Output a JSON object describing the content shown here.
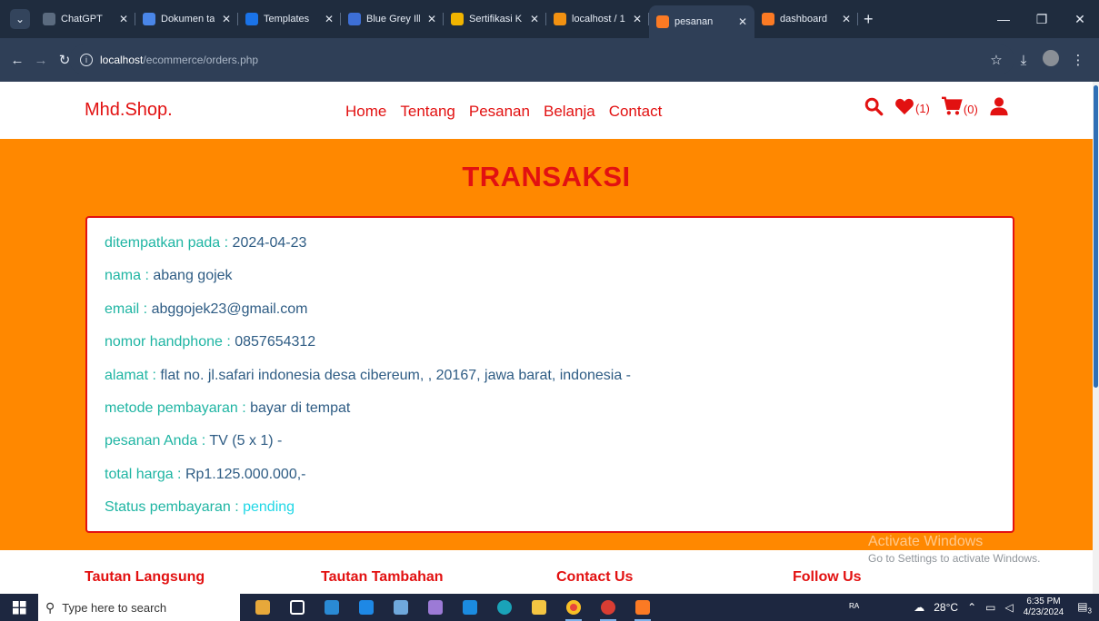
{
  "browser": {
    "tabs": [
      {
        "title": "ChatGPT",
        "icon": "chatgpt-icon",
        "color": "#5b6b7f",
        "active": false
      },
      {
        "title": "Dokumen ta",
        "icon": "docs-icon",
        "color": "#4a86e8",
        "active": false
      },
      {
        "title": "Templates",
        "icon": "templates-icon",
        "color": "#1a73e8",
        "active": false
      },
      {
        "title": "Blue Grey Ill",
        "icon": "youtube-icon",
        "color": "#3d6fd6",
        "active": false
      },
      {
        "title": "Sertifikasi K",
        "icon": "sertifikasi-icon",
        "color": "#f0b400",
        "active": false
      },
      {
        "title": "localhost / 1",
        "icon": "phpmyadmin-icon",
        "color": "#f29111",
        "active": false
      },
      {
        "title": "pesanan",
        "icon": "xampp-icon",
        "color": "#fb7a24",
        "active": true
      },
      {
        "title": "dashboard",
        "icon": "xampp-icon",
        "color": "#fb7a24",
        "active": false
      }
    ],
    "url_host": "localhost",
    "url_path": "/ecommerce/orders.php"
  },
  "site": {
    "logo": "Mhd.Shop.",
    "nav": [
      "Home",
      "Tentang",
      "Pesanan",
      "Belanja",
      "Contact"
    ],
    "wishlist_count": "(1)",
    "cart_count": "(0)",
    "brand_color": "#e21111",
    "section_bg": "#ff8800"
  },
  "orders": {
    "title": "TRANSAKSI",
    "order": [
      {
        "label": "ditempatkan pada : ",
        "value": "2024-04-23"
      },
      {
        "label": "nama : ",
        "value": "abang gojek"
      },
      {
        "label": "email : ",
        "value": "abggojek23@gmail.com"
      },
      {
        "label": "nomor handphone : ",
        "value": "0857654312"
      },
      {
        "label": "alamat : ",
        "value": "flat no. jl.safari indonesia desa cibereum, , 20167, jawa barat, indonesia -"
      },
      {
        "label": "metode pembayaran : ",
        "value": "bayar di tempat"
      },
      {
        "label": "pesanan Anda : ",
        "value": "TV (5 x 1) -"
      },
      {
        "label": "total harga : ",
        "value": "Rp1.125.000.000,-"
      },
      {
        "label": "Status pembayaran : ",
        "value": "pending"
      }
    ]
  },
  "footer": {
    "columns": [
      "Tautan Langsung",
      "Tautan Tambahan",
      "Contact Us",
      "Follow Us"
    ]
  },
  "watermark": {
    "title": "Activate Windows",
    "subtitle": "Go to Settings to activate Windows."
  },
  "taskbar": {
    "search_placeholder": "Type here to search",
    "weather": "28°C",
    "time": "6:35 PM",
    "date": "4/23/2024",
    "notification_count": "3"
  }
}
